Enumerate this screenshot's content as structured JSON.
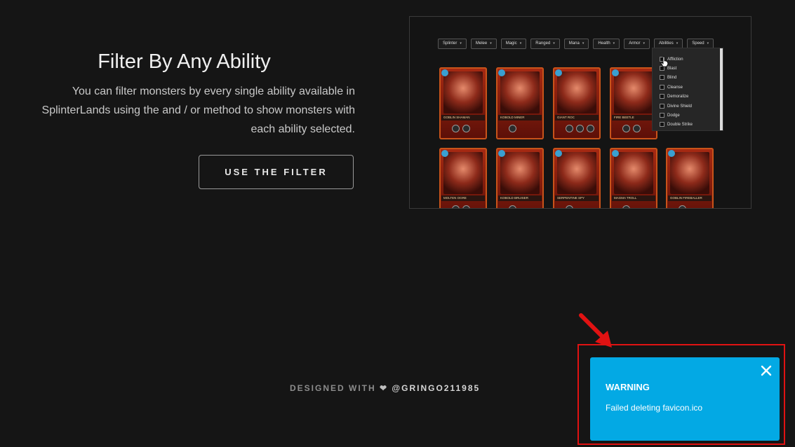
{
  "hero": {
    "title": "Filter By Any Ability",
    "description": "You can filter monsters by every single ability available in SplinterLands using the and / or method to show monsters with each ability selected.",
    "button_label": "USE THE FILTER"
  },
  "preview": {
    "filters": [
      "Splinter",
      "Melee",
      "Magic",
      "Ranged",
      "Mana",
      "Health",
      "Armor",
      "Abilities",
      "Speed"
    ],
    "abilities_options": [
      "Affliction",
      "Blast",
      "Blind",
      "Cleanse",
      "Demoralize",
      "Divine Shield",
      "Dodge",
      "Double Strike"
    ],
    "cards_row1": [
      "GOBLIN SHAMAN",
      "KOBOLD MINER",
      "GIANT ROC",
      "FIRE BEETLE"
    ],
    "cards_row2": [
      "MOLTEN OGRE",
      "KOBOLD BRUISER",
      "SERPENTINE SPY",
      "MAGMA TROLL",
      "GOBLIN FIREBALLER"
    ]
  },
  "footer": {
    "prefix": "DESIGNED WITH",
    "heart": "❤",
    "handle": "@GRINGO211985"
  },
  "toast": {
    "title": "WARNING",
    "message": "Failed deleting favicon.ico",
    "color": "#03a9e4"
  }
}
